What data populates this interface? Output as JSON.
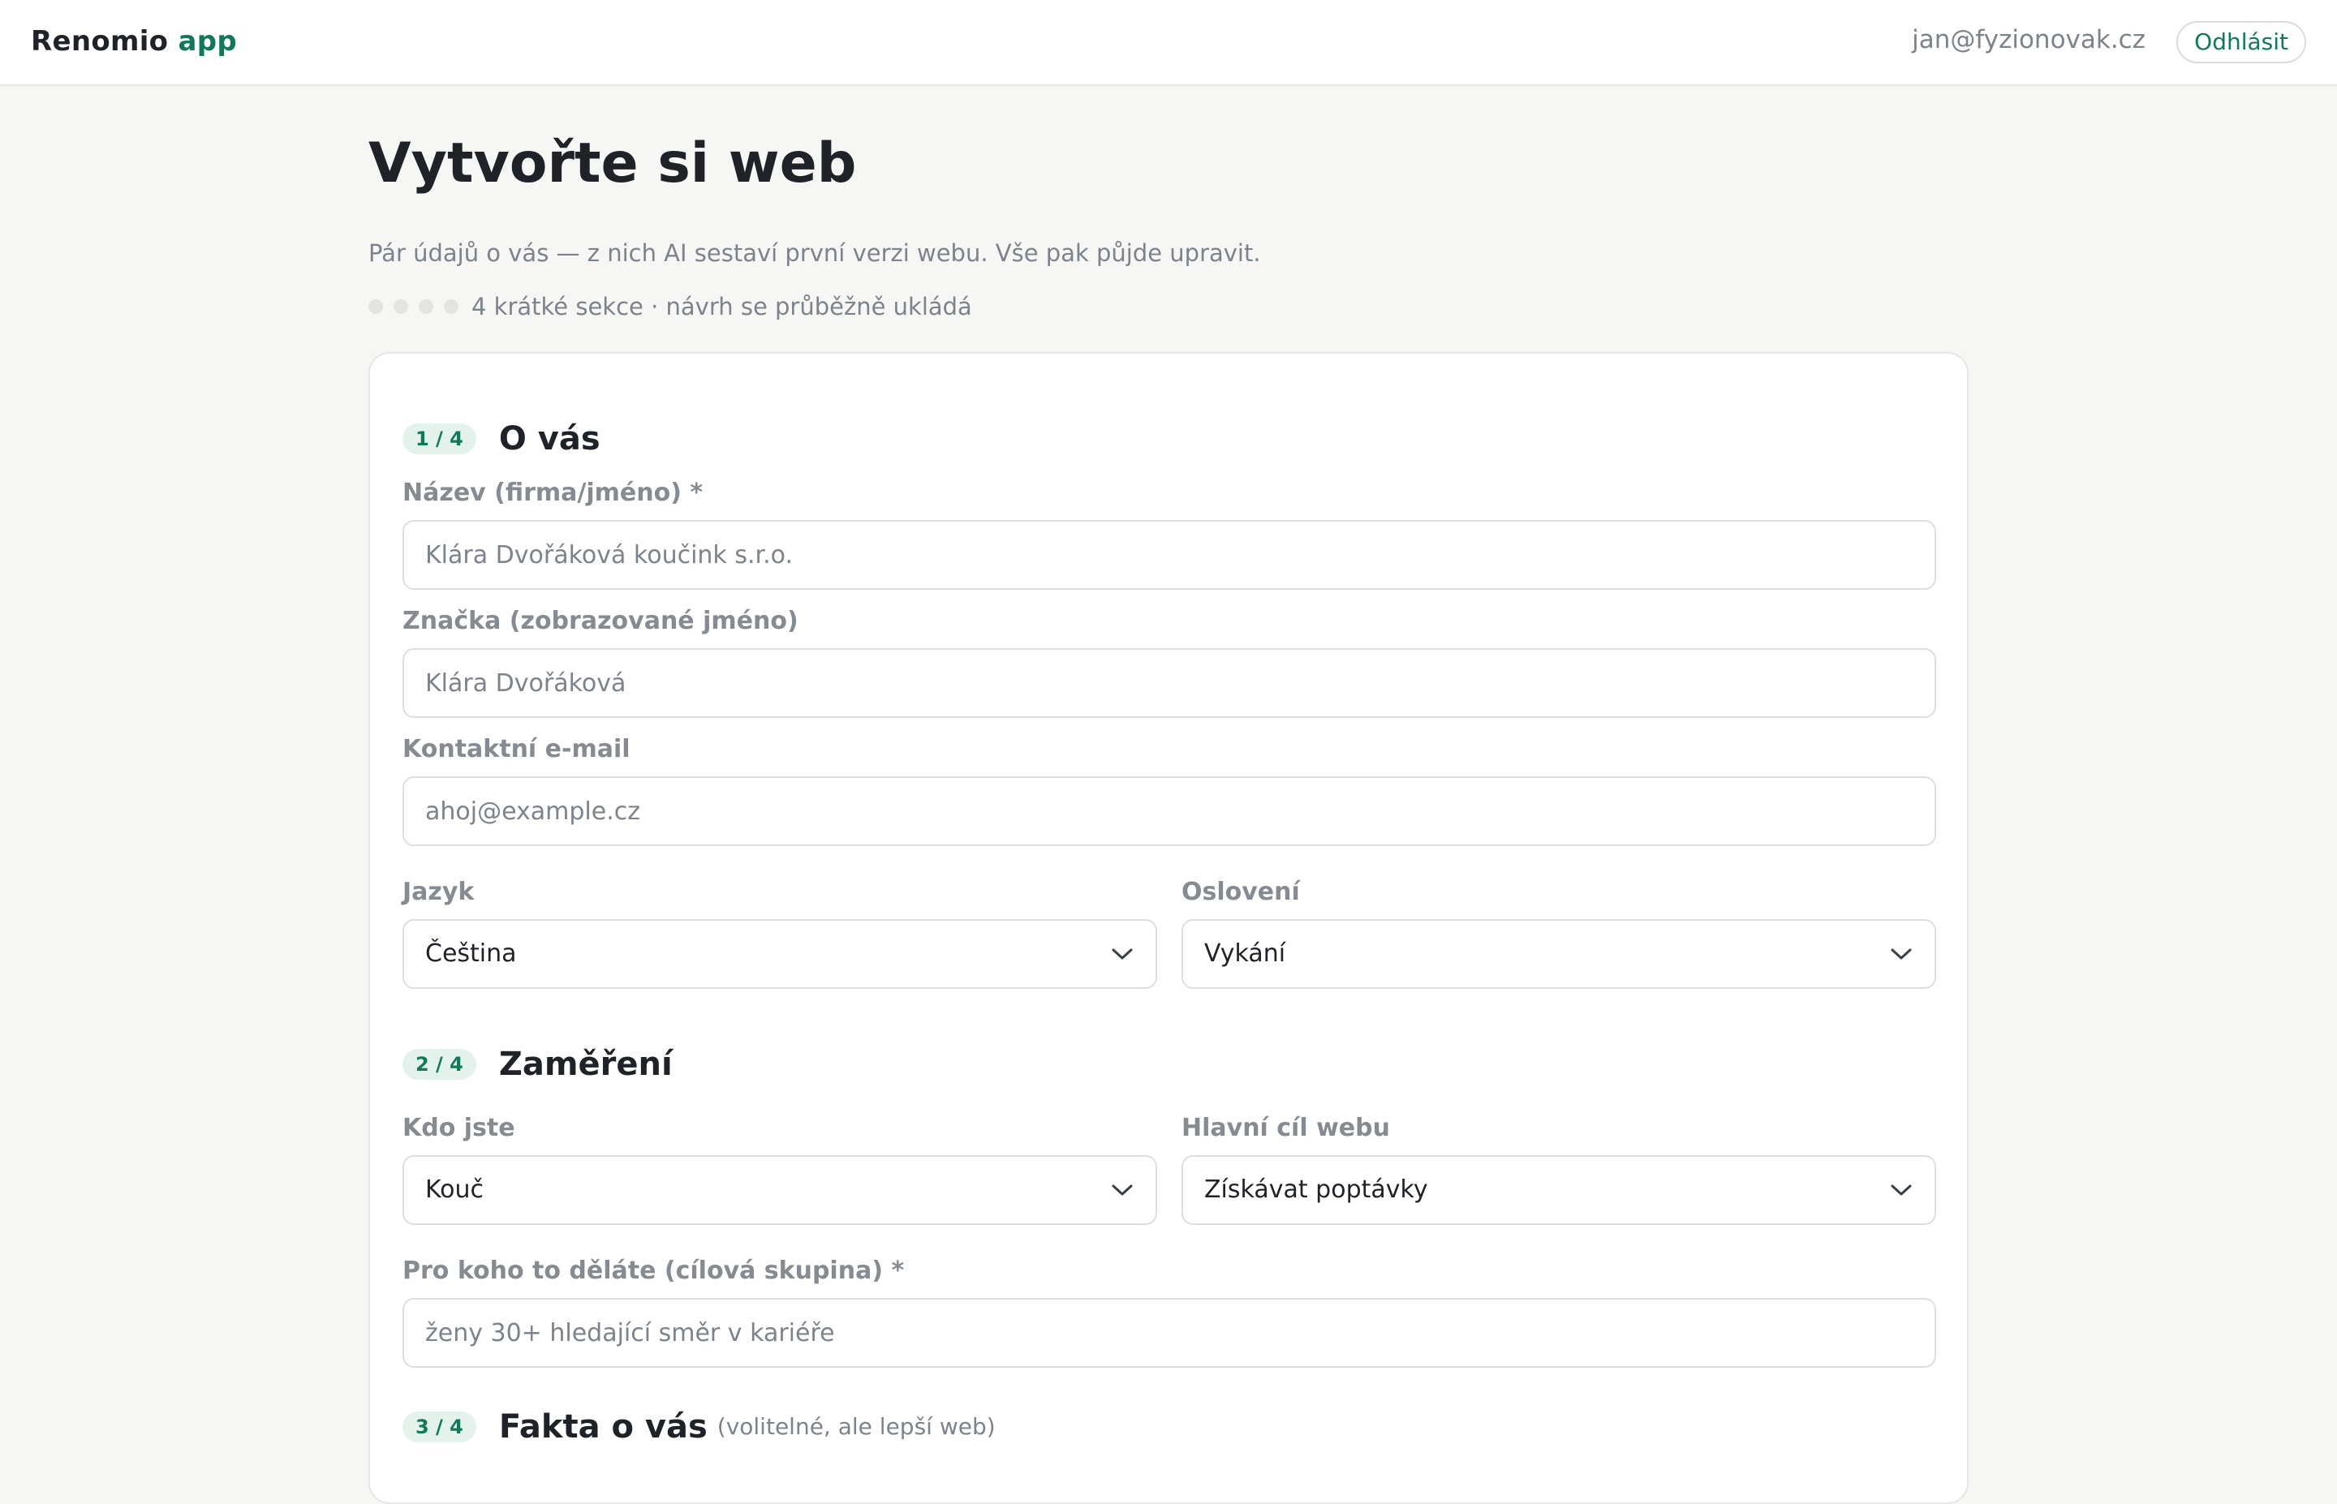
{
  "app": {
    "brand_name": "Renomio",
    "brand_suffix": "app",
    "accent_color": "#0f7a5a"
  },
  "header": {
    "user_email": "jan@fyzionovak.cz",
    "logout_label": "Odhlásit"
  },
  "page": {
    "title": "Vytvořte si web",
    "subtitle": "Pár údajů o vás — z nich AI sestaví první verzi webu. Vše pak půjde upravit.",
    "progress_text": "4 krátké sekce · návrh se průběžně ukládá",
    "progress_steps_total": 4,
    "progress_steps_done": 0
  },
  "sections": [
    {
      "badge": "1 / 4",
      "title": "O vás",
      "fields": {
        "name": {
          "label": "Název (firma/jméno) *",
          "placeholder": "Klára Dvořáková koučink s.r.o.",
          "value": ""
        },
        "brand": {
          "label": "Značka (zobrazované jméno)",
          "placeholder": "Klára Dvořáková",
          "value": ""
        },
        "email": {
          "label": "Kontaktní e-mail",
          "placeholder": "ahoj@example.cz",
          "value": ""
        },
        "language": {
          "label": "Jazyk",
          "value": "Čeština"
        },
        "address": {
          "label": "Oslovení",
          "value": "Vykání"
        }
      }
    },
    {
      "badge": "2 / 4",
      "title": "Zaměření",
      "fields": {
        "who": {
          "label": "Kdo jste",
          "value": "Kouč"
        },
        "goal": {
          "label": "Hlavní cíl webu",
          "value": "Získávat poptávky"
        },
        "audience": {
          "label": "Pro koho to děláte (cílová skupina) *",
          "placeholder": "ženy 30+ hledající směr v kariéře",
          "value": ""
        }
      }
    },
    {
      "badge": "3 / 4",
      "title": "Fakta o vás",
      "note": "(volitelné, ale lepší web)"
    }
  ],
  "icons": {
    "select_arrow": "chevron-down-icon"
  }
}
